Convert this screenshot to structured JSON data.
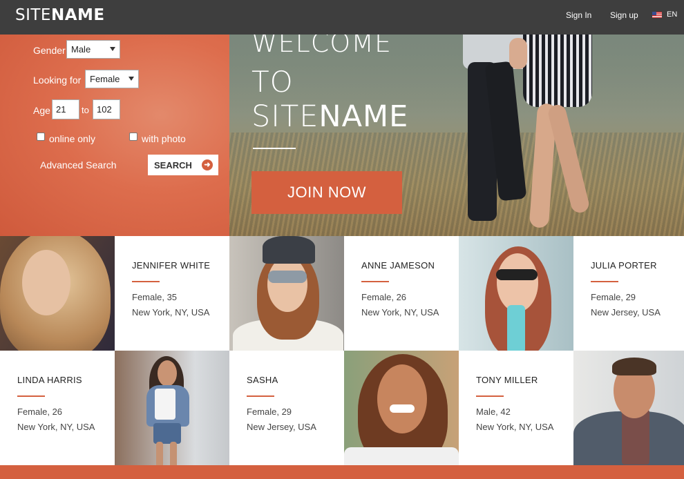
{
  "header": {
    "logo_light": "SITE",
    "logo_bold": "NAME",
    "sign_in": "Sign In",
    "sign_up": "Sign up",
    "language": "EN"
  },
  "search": {
    "gender_label": "Gender",
    "gender_value": "Male",
    "looking_for_label": "Looking for",
    "looking_for_value": "Female",
    "age_label": "Age",
    "age_from": "21",
    "age_to_label": "to",
    "age_to": "102",
    "online_only_label": "online only",
    "with_photo_label": "with photo",
    "advanced_search_label": "Advanced Search",
    "search_button_label": "SEARCH"
  },
  "hero": {
    "line1": "WELCOME",
    "line2": "TO",
    "line3_light": "SITE",
    "line3_bold": "NAME",
    "join_button_label": "JOIN NOW"
  },
  "profiles": [
    {
      "name": "JENNIFER WHITE",
      "gender_age": "Female, 35",
      "location": "New York, NY, USA"
    },
    {
      "name": "ANNE JAMESON",
      "gender_age": "Female, 26",
      "location": "New York, NY, USA"
    },
    {
      "name": "JULIA PORTER",
      "gender_age": "Female, 29",
      "location": "New Jersey, USA"
    },
    {
      "name": "LINDA HARRIS",
      "gender_age": "Female, 26",
      "location": "New York, NY, USA"
    },
    {
      "name": "SASHA",
      "gender_age": "Female, 29",
      "location": "New Jersey, USA"
    },
    {
      "name": "TONY MILLER",
      "gender_age": "Male, 42",
      "location": "New York, NY, USA"
    }
  ],
  "colors": {
    "accent": "#d4603f",
    "header_bg": "#3e3e3e"
  }
}
